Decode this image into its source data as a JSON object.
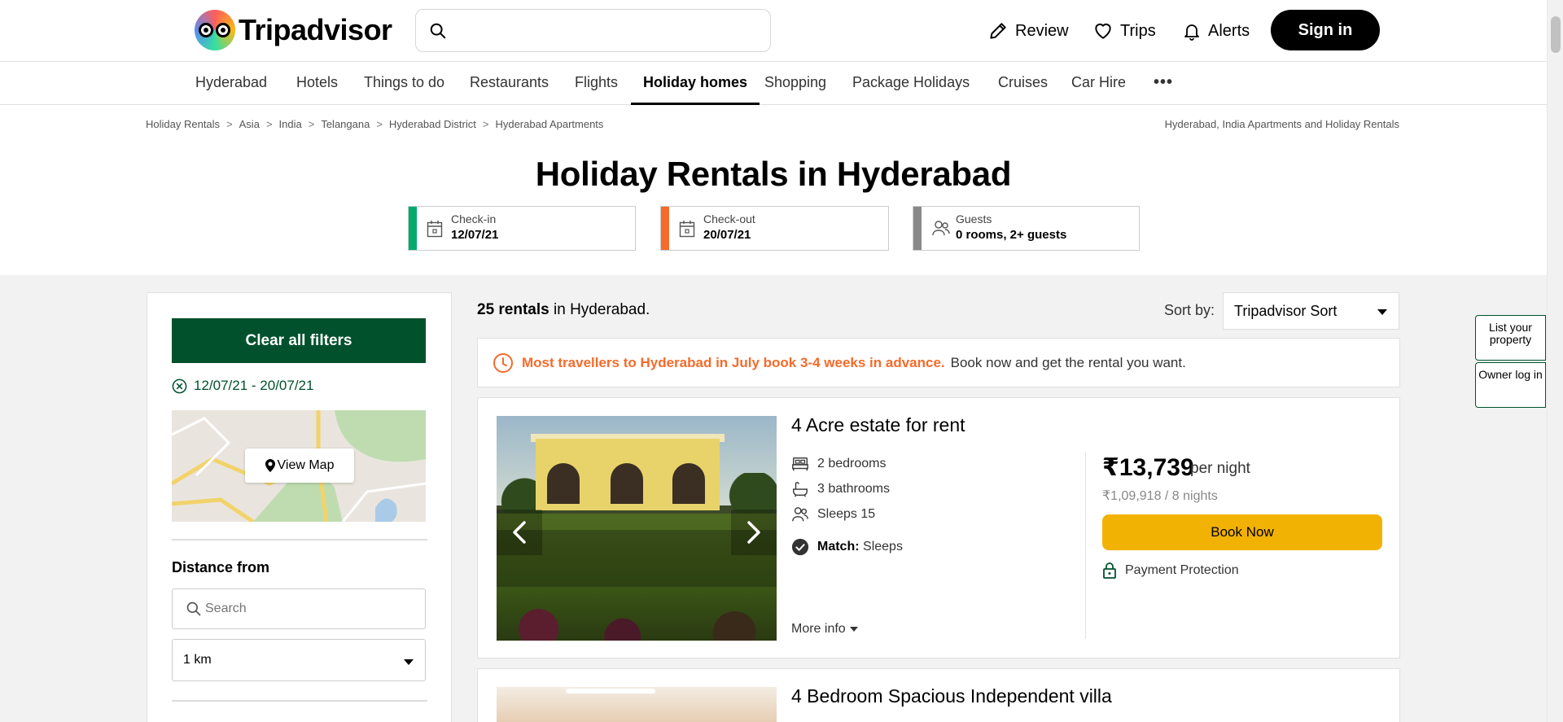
{
  "header": {
    "logo_text": "Tripadvisor",
    "search_placeholder": "",
    "review": "Review",
    "trips": "Trips",
    "alerts": "Alerts",
    "signin": "Sign in"
  },
  "tabs": [
    "Hyderabad",
    "Hotels",
    "Things to do",
    "Restaurants",
    "Flights",
    "Holiday homes",
    "Shopping",
    "Package Holidays",
    "Cruises",
    "Car Hire",
    "•••"
  ],
  "active_tab": "Holiday homes",
  "breadcrumb": [
    "Holiday Rentals",
    "Asia",
    "India",
    "Telangana",
    "Hyderabad District",
    "Hyderabad Apartments"
  ],
  "breadcrumb_sep": ">",
  "breadcrumb_right": "Hyderabad, India Apartments and Holiday Rentals",
  "title": "Holiday Rentals in Hyderabad",
  "dates": {
    "checkin_label": "Check-in",
    "checkin_value": "12/07/21",
    "checkout_label": "Check-out",
    "checkout_value": "20/07/21",
    "guests_label": "Guests",
    "guests_value": "0 rooms, 2+ guests"
  },
  "colors": {
    "checkin_bar": "#00aa6c",
    "checkout_bar": "#f56b2a",
    "guests_bar": "#888888",
    "brand_green": "#00512c",
    "book_yellow": "#f2b203",
    "tip_orange": "#f56b2a"
  },
  "sidebar": {
    "clear_filters": "Clear all filters",
    "date_range": "12/07/21 - 20/07/21",
    "view_map": "View Map",
    "distance_title": "Distance from",
    "distance_search_placeholder": "Search",
    "distance_value": "1 km"
  },
  "results": {
    "count": "25 rentals",
    "count_suffix": "in Hyderabad.",
    "sort_label": "Sort by:",
    "sort_value": "Tripadvisor Sort"
  },
  "tip": {
    "highlight": "Most travellers to Hyderabad in July book 3-4 weeks in advance.",
    "rest": "Book now and get the rental you want."
  },
  "listing1": {
    "title": "4 Acre estate for rent",
    "bedrooms": "2 bedrooms",
    "bathrooms": "3 bathrooms",
    "sleeps": "Sleeps 15",
    "match_label": "Match:",
    "match_value": "Sleeps",
    "more_info": "More info",
    "price": "₹13,739",
    "price_unit": "per night",
    "price_total": "₹1,09,918 / 8 nights",
    "book": "Book Now",
    "protection": "Payment Protection"
  },
  "listing2": {
    "title": "4 Bedroom Spacious Independent villa"
  },
  "side": {
    "list_property": "List your property",
    "owner_login": "Owner log in"
  }
}
